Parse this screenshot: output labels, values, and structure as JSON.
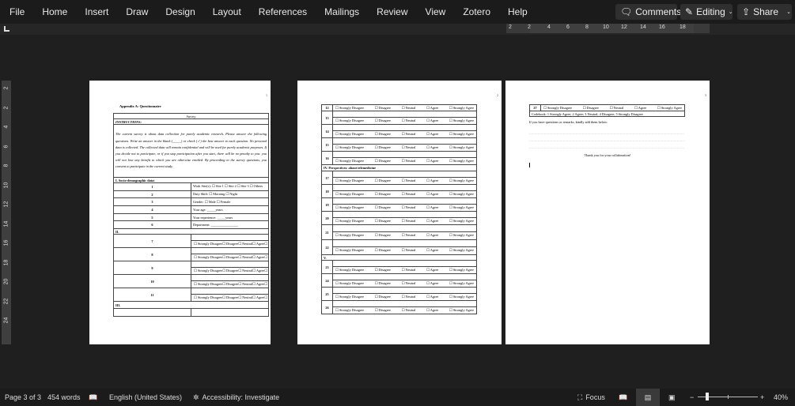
{
  "menu": [
    "File",
    "Home",
    "Insert",
    "Draw",
    "Design",
    "Layout",
    "References",
    "Mailings",
    "Review",
    "View",
    "Zotero",
    "Help"
  ],
  "ribbon": {
    "comments": "Comments",
    "editing": "Editing",
    "share": "Share"
  },
  "hruler": [
    "2",
    "2",
    "4",
    "6",
    "8",
    "10",
    "12",
    "14",
    "16",
    "18"
  ],
  "vruler": [
    "2",
    "2",
    "4",
    "6",
    "8",
    "10",
    "12",
    "14",
    "16",
    "18",
    "20",
    "22",
    "24"
  ],
  "options": [
    "Strongly Disagree",
    "Disagree",
    "Neutral",
    "Agree",
    "Strongly Agree"
  ],
  "checkbox": "☐",
  "page1": {
    "num": "1",
    "heading": "Appendix A: Questionnaire",
    "survey": "Survey",
    "instructions_label": "INSTRUCTIONS:",
    "instructions": "The current survey is about data collection for purely academic research. Please answer the following questions.  Write an answer in the blank (_____) or check (✓) the best answer to each question. No personal data is collected. The collected data will remain confidential and will be used for purely academic purposes. If you decide not to participate, or if you stop participation after you start, there will be no penalty to you: you will not lose any benefit to which you are otherwise entitled. By proceeding to the survey questions, you consent to participate in the current study.",
    "section1": "I. Socio-demographic data:",
    "demo": [
      {
        "n": "1",
        "t": "Work Site(s):    ☐ Site 1 ☐ Site 2 ☐ Site 3  ☐ Others"
      },
      {
        "n": "2",
        "t": "Duty Shift:       ☐ Morning     ☐ Night"
      },
      {
        "n": "3",
        "t": "Gender:            ☐   Male      ☐   Female"
      },
      {
        "n": "4",
        "t": "Your age: _____years"
      },
      {
        "n": "5",
        "t": "Your experience: _____years"
      },
      {
        "n": "6",
        "t": "Department: ________________"
      }
    ],
    "section2": "II.",
    "items2": [
      "7",
      "8",
      "9",
      "10",
      "11"
    ],
    "section3": "III."
  },
  "page2": {
    "num": "2",
    "first": "12",
    "itemsA": [
      "13",
      "14",
      "15",
      "16"
    ],
    "section4": "IV. Perspectives: about telemedicine",
    "itemsB": [
      "17",
      "18",
      "19",
      "20"
    ],
    "itemsC": [
      "21",
      "22"
    ],
    "section5": "V.",
    "itemsD": [
      "23",
      "24",
      "25",
      "26"
    ]
  },
  "page3": {
    "num": "3",
    "item": "27",
    "codebook": "Codebook: 1 Strongly Agree; 2 Agree; 3 Neutral; 4 Disagree; 5 Strongly Disagree",
    "remarks": "If you have questions or remarks, kindly add them below:",
    "dots": "…………………………………………………………………………………………………………………………………",
    "thanks": "Thank you for your collaboration!"
  },
  "status": {
    "page": "Page 3 of 3",
    "words": "454 words",
    "language": "English (United States)",
    "accessibility": "Accessibility: Investigate",
    "focus": "Focus",
    "zoom": "40%",
    "zoom_level": 40
  }
}
